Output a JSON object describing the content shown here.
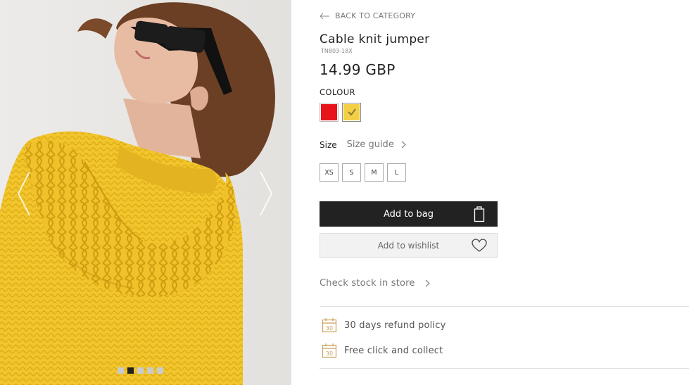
{
  "gallery": {
    "image_alt": "Model wearing yellow cable knit jumper and sunglasses",
    "slide_count": 5,
    "active_slide": 2
  },
  "product": {
    "back_label": "BACK TO CATEGORY",
    "title": "Cable knit jumper",
    "sku": "TN803-18X",
    "price": "14.99 GBP",
    "colour_label": "COLOUR",
    "colours": [
      {
        "name": "red",
        "hex": "#e8141b",
        "selected": false
      },
      {
        "name": "yellow",
        "hex": "#f3cf45",
        "selected": true
      }
    ],
    "size_label": "Size",
    "size_guide_label": "Size guide",
    "sizes": [
      "XS",
      "S",
      "M",
      "L"
    ],
    "add_to_bag_label": "Add to bag",
    "add_to_wishlist_label": "Add to wishlist",
    "check_stock_label": "Check stock in store"
  },
  "perks": [
    {
      "icon": "calendar-30-icon",
      "icon_text": "30",
      "label": "30 days refund policy"
    },
    {
      "icon": "calendar-30-icon",
      "icon_text": "30",
      "label": "Free click and collect"
    }
  ],
  "colors": {
    "accent_dark": "#222222",
    "perk_icon": "#c9a15a"
  }
}
